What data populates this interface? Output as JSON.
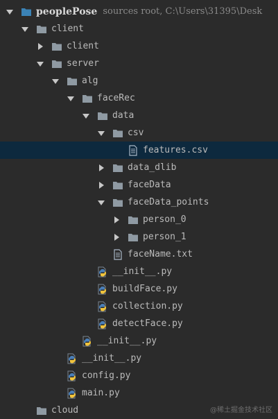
{
  "colors": {
    "background": "#2b2b2b",
    "selection": "#0d293e",
    "text": "#bbbbbb",
    "folder": "#8f9aa3",
    "root_folder": "#3b83b6"
  },
  "tree": [
    {
      "label": "peoplePose",
      "hint": "sources root, C:\\Users\\31395\\Desk",
      "icon": "root-folder-icon",
      "expanded": true,
      "depth": 0,
      "root": true
    },
    {
      "label": "client",
      "icon": "folder-icon",
      "expanded": true,
      "depth": 1
    },
    {
      "label": "client",
      "icon": "folder-icon",
      "expanded": false,
      "depth": 2
    },
    {
      "label": "server",
      "icon": "folder-icon",
      "expanded": true,
      "depth": 2
    },
    {
      "label": "alg",
      "icon": "folder-icon",
      "expanded": true,
      "depth": 3
    },
    {
      "label": "faceRec",
      "icon": "folder-icon",
      "expanded": true,
      "depth": 4
    },
    {
      "label": "data",
      "icon": "folder-icon",
      "expanded": true,
      "depth": 5
    },
    {
      "label": "csv",
      "icon": "folder-icon",
      "expanded": true,
      "depth": 6
    },
    {
      "label": "features.csv",
      "icon": "text-file-icon",
      "depth": 7,
      "selected": true
    },
    {
      "label": "data_dlib",
      "icon": "folder-icon",
      "expanded": false,
      "depth": 6
    },
    {
      "label": "faceData",
      "icon": "folder-icon",
      "expanded": false,
      "depth": 6
    },
    {
      "label": "faceData_points",
      "icon": "folder-icon",
      "expanded": true,
      "depth": 6
    },
    {
      "label": "person_0",
      "icon": "folder-icon",
      "expanded": false,
      "depth": 7
    },
    {
      "label": "person_1",
      "icon": "folder-icon",
      "expanded": false,
      "depth": 7
    },
    {
      "label": "faceName.txt",
      "icon": "text-file-icon",
      "depth": 6
    },
    {
      "label": "__init__.py",
      "icon": "python-file-icon",
      "depth": 5
    },
    {
      "label": "buildFace.py",
      "icon": "python-file-icon",
      "depth": 5
    },
    {
      "label": "collection.py",
      "icon": "python-file-icon",
      "depth": 5
    },
    {
      "label": "detectFace.py",
      "icon": "python-file-icon",
      "depth": 5
    },
    {
      "label": "__init__.py",
      "icon": "python-file-icon",
      "depth": 4
    },
    {
      "label": "__init__.py",
      "icon": "python-file-icon",
      "depth": 3
    },
    {
      "label": "config.py",
      "icon": "python-file-icon",
      "depth": 3
    },
    {
      "label": "main.py",
      "icon": "python-file-icon",
      "depth": 3
    },
    {
      "label": "cloud",
      "icon": "folder-icon",
      "depth": 1
    }
  ],
  "watermark": "@稀土掘金技术社区"
}
